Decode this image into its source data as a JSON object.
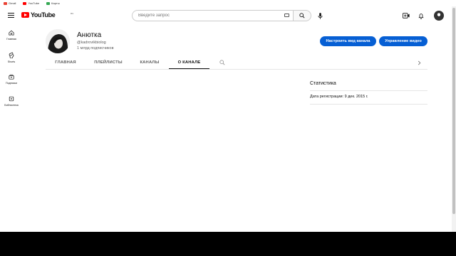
{
  "bookmarks": [
    {
      "label": "Gmail"
    },
    {
      "label": "YouTube"
    },
    {
      "label": "Карты"
    }
  ],
  "masthead": {
    "logo_text": "YouTube",
    "region_code": "RU",
    "search_placeholder": "Введите запрос"
  },
  "sidebar": {
    "items": [
      {
        "label": "Главная",
        "icon": "home-icon"
      },
      {
        "label": "Shorts",
        "icon": "shorts-icon"
      },
      {
        "label": "Подписки",
        "icon": "subscriptions-icon"
      },
      {
        "label": "Библиотека",
        "icon": "library-icon"
      }
    ]
  },
  "channel": {
    "name": "Анютка",
    "handle": "@kadrovikbiolog",
    "subscribers": "1 млрд подписчиков",
    "customize_label": "Настроить вид канала",
    "manage_label": "Управление видео"
  },
  "tabs": [
    {
      "label": "ГЛАВНАЯ",
      "active": false
    },
    {
      "label": "ПЛЕЙЛИСТЫ",
      "active": false
    },
    {
      "label": "КАНАЛЫ",
      "active": false
    },
    {
      "label": "О КАНАЛЕ",
      "active": true
    }
  ],
  "stats": {
    "title": "Статистика",
    "registered": "Дата регистрации: 9 дек. 2015 г."
  },
  "colors": {
    "brand_red": "#ff0000",
    "accent_blue": "#065fd4"
  }
}
